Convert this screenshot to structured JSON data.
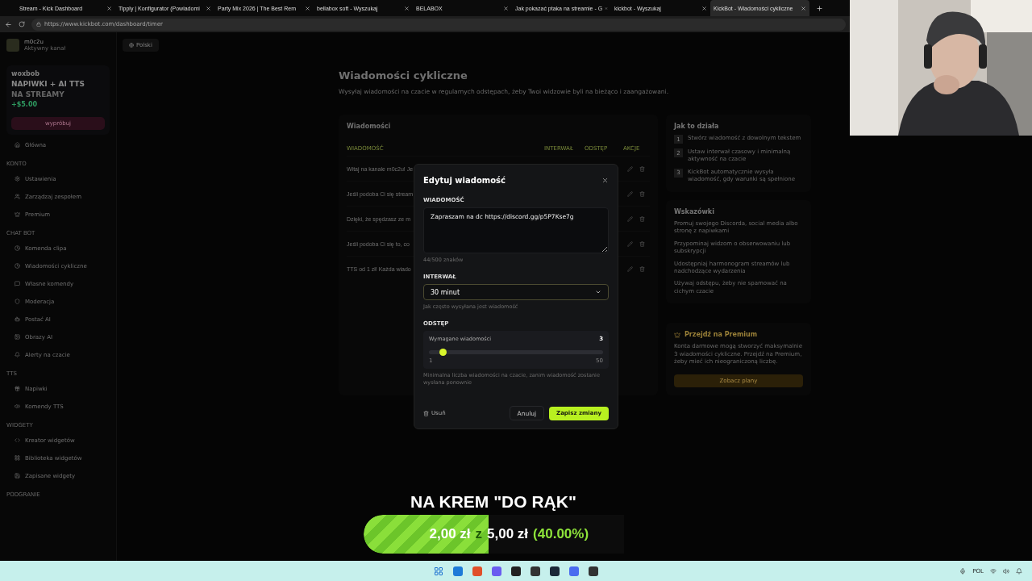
{
  "browser": {
    "tabs": [
      {
        "title": "Stream - Kick Dashboard",
        "selected": false
      },
      {
        "title": "Tipply | Konfigurator (Powiadomi",
        "selected": false
      },
      {
        "title": "Party Mix 2026 | The Best Rem",
        "selected": false
      },
      {
        "title": "bellabox soft - Wyszukaj",
        "selected": false
      },
      {
        "title": "BELABOX",
        "selected": false
      },
      {
        "title": "Jak pokazać ptaka na streamie - G",
        "selected": false
      },
      {
        "title": "kickbot - Wyszukaj",
        "selected": false
      },
      {
        "title": "KickBot - Wiadomości cykliczne",
        "selected": true
      }
    ],
    "address": "https://www.kickbot.com/dashboard/timer"
  },
  "sidebar": {
    "user": {
      "name": "m0c2u",
      "subtitle": "Aktywny kanał"
    },
    "ad": {
      "brand": "woxbob",
      "headline": "NAPIWKI + AI TTS",
      "subline": "NA STREAMY",
      "amount": "+$5.00",
      "button": "wypróbuj"
    },
    "sections": [
      {
        "items": [
          "Główna"
        ]
      },
      {
        "title": "KONTO",
        "items": [
          "Ustawienia",
          "Zarządzaj zespołem",
          "Premium"
        ]
      },
      {
        "title": "CHAT BOT",
        "items": [
          "Komenda clipa",
          "Wiadomości cykliczne",
          "Własne komendy",
          "Moderacja",
          "Postać AI",
          "Obrazy AI",
          "Alerty na czacie"
        ]
      },
      {
        "title": "TTS",
        "items": [
          "Napiwki",
          "Komendy TTS"
        ]
      },
      {
        "title": "WIDGETY",
        "items": [
          "Kreator widgetów",
          "Biblioteka widgetów",
          "Zapisane widgety"
        ]
      },
      {
        "title": "PODGRANIE"
      }
    ]
  },
  "language": "Polski",
  "page": {
    "title": "Wiadomości cykliczne",
    "subtitle": "Wysyłaj wiadomości na czacie w regularnych odstępach, żeby Twoi widzowie byli na bieżąco i zaangażowani.",
    "messages_card": {
      "title": "Wiadomości",
      "columns": [
        "WIADOMOŚĆ",
        "INTERWAŁ",
        "ODSTĘP",
        "AKCJE"
      ],
      "rows": [
        "Witaj na kanale m0c2u! Je",
        "Jeśli podoba Ci się stream",
        "Dzięki, że spędzasz ze m",
        "Jeśli podoba Ci się to, co",
        "TTS od 1 zł! Każda wiado"
      ]
    },
    "how_it_works": {
      "title": "Jak to działa",
      "steps": [
        {
          "number": "1",
          "text": "Stwórz wiadomość z dowolnym tekstem"
        },
        {
          "number": "2",
          "text": "Ustaw interwał czasowy i minimalną aktywność na czacie"
        },
        {
          "number": "3",
          "text": "KickBot automatycznie wysyła wiadomość, gdy warunki są spełnione"
        }
      ]
    },
    "tips": {
      "title": "Wskazówki",
      "items": [
        "Promuj swojego Discorda, social media albo stronę z napiwkami",
        "Przypominaj widzom o obserwowaniu lub subskrypcji",
        "Udostępniaj harmonogram streamów lub nadchodzące wydarzenia",
        "Używaj odstępu, żeby nie spamować na cichym czacie"
      ]
    },
    "premium": {
      "title": "Przejdź na Premium",
      "text": "Konta darmowe mogą stworzyć maksymalnie 3 wiadomości cykliczne. Przejdź na Premium, żeby mieć ich nieograniczoną liczbę.",
      "button": "Zobacz plany"
    }
  },
  "modal": {
    "title": "Edytuj wiadomość",
    "message_label": "WIADOMOŚĆ",
    "message": "Zapraszam na dc https://discord.gg/p5P7Kse7g",
    "counter": "44/500 znaków",
    "interval_label": "INTERWAŁ",
    "interval": "30 minut",
    "interval_help": "Jak często wysyłana jest wiadomość",
    "gap_label": "ODSTĘP",
    "slider": {
      "label": "Wymagane wiadomości",
      "value": "3",
      "min": "1",
      "max": "50",
      "level": 0.08
    },
    "gap_help": "Minimalna liczba wiadomości na czacie, zanim wiadomość zostanie wysłana ponownie",
    "delete": "Usuń",
    "cancel": "Anuluj",
    "save": "Zapisz zmiany"
  },
  "overlay": {
    "goal_title": "NA KREM \"DO RĄK\"",
    "current": "2,00 zł",
    "separator": "z",
    "target": "5,00 zł",
    "percent": "(40.00%)",
    "level": 0.48
  },
  "taskbar": {
    "language": "POL"
  }
}
